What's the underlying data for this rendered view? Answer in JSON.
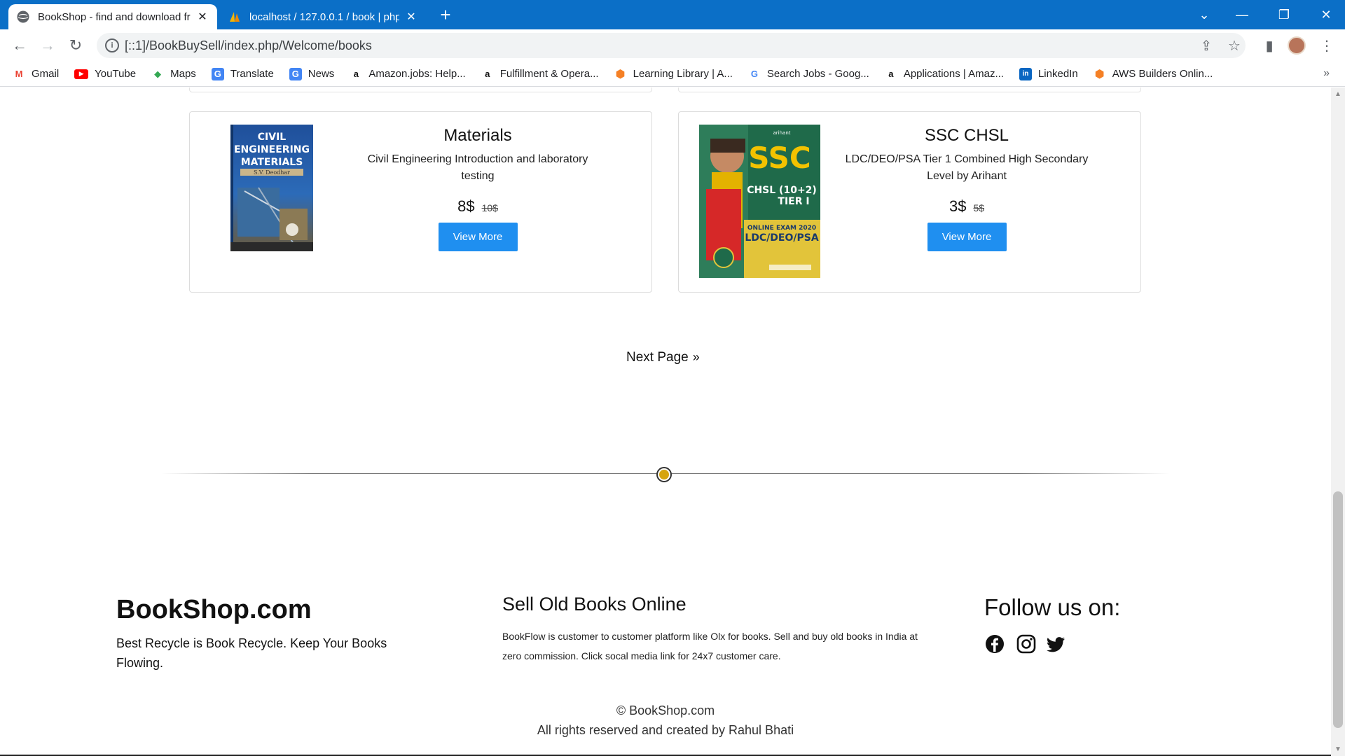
{
  "browser": {
    "tabs": [
      {
        "title": "BookShop - find and download fr",
        "close": "✕"
      },
      {
        "title": "localhost / 127.0.0.1 / book | php",
        "close": "✕"
      }
    ],
    "new_tab": "+",
    "url": "[::1]/BookBuySell/index.php/Welcome/books",
    "window_controls": {
      "minimize": "—",
      "restore": "❐",
      "close": "✕",
      "tab_search": "⌄"
    },
    "bookmarks": [
      {
        "label": "Gmail",
        "icon": "gmail-icon",
        "glyph": "M",
        "color": "#ea4335"
      },
      {
        "label": "YouTube",
        "icon": "youtube-icon",
        "glyph": "▶",
        "color": "#ff0000"
      },
      {
        "label": "Maps",
        "icon": "maps-icon",
        "glyph": "◆",
        "color": "#34a853"
      },
      {
        "label": "Translate",
        "icon": "translate-icon",
        "glyph": "G",
        "color": "#4285f4"
      },
      {
        "label": "News",
        "icon": "news-icon",
        "glyph": "G",
        "color": "#4285f4"
      },
      {
        "label": "Amazon.jobs: Help...",
        "icon": "amazon-icon",
        "glyph": "a",
        "color": "#111111"
      },
      {
        "label": "Fulfillment & Opera...",
        "icon": "amazon-icon",
        "glyph": "a",
        "color": "#111111"
      },
      {
        "label": "Learning Library | A...",
        "icon": "aws-cube-icon",
        "glyph": "⬢",
        "color": "#f58025"
      },
      {
        "label": "Search Jobs - Goog...",
        "icon": "google-icon",
        "glyph": "G",
        "color": "#4285f4"
      },
      {
        "label": "Applications | Amaz...",
        "icon": "amazon-icon",
        "glyph": "a",
        "color": "#111111"
      },
      {
        "label": "LinkedIn",
        "icon": "linkedin-icon",
        "glyph": "in",
        "color": "#0a66c2"
      },
      {
        "label": "AWS Builders Onlin...",
        "icon": "aws-cube-icon",
        "glyph": "⬢",
        "color": "#f58025"
      }
    ],
    "bookmarks_more": "»"
  },
  "books": [
    {
      "title": "Materials",
      "description": "Civil Engineering Introduction and laboratory testing",
      "price": "8$",
      "old_price": "10$",
      "button": "View More",
      "cover_lines": [
        "CIVIL",
        "ENGINEERING",
        "MATERIALS"
      ],
      "cover_author": "S.V. Deodhar"
    },
    {
      "title": "SSC CHSL",
      "description": "LDC/DEO/PSA Tier 1 Combined High Secondary Level by Arihant",
      "price": "3$",
      "old_price": "5$",
      "button": "View More",
      "cover_big": "SSC",
      "cover_sub": "CHSL (10+2)",
      "cover_tier": "TIER I",
      "cover_exam": "ONLINE EXAM 2020",
      "cover_post": "LDC/DEO/PSA",
      "cover_publisher": "arihant"
    }
  ],
  "pagination": {
    "next": "Next Page",
    "chevron": "»"
  },
  "footer": {
    "brand": "BookShop.com",
    "tagline": "Best Recycle is Book Recycle. Keep Your Books Flowing.",
    "sell_heading": "Sell Old Books Online",
    "sell_text": "BookFlow is customer to customer platform like Olx for books. Sell and buy old books in India at zero commission. Click socal media link for 24x7 customer care.",
    "follow_heading": "Follow us on:",
    "social": [
      "facebook-icon",
      "instagram-icon",
      "twitter-icon"
    ],
    "copyright": "© BookShop.com",
    "rights": "All rights reserved and created by Rahul Bhati"
  },
  "colors": {
    "tabbar": "#0b6fc7",
    "button": "#1f8ff0",
    "divider_dot": "#d6a40e"
  }
}
